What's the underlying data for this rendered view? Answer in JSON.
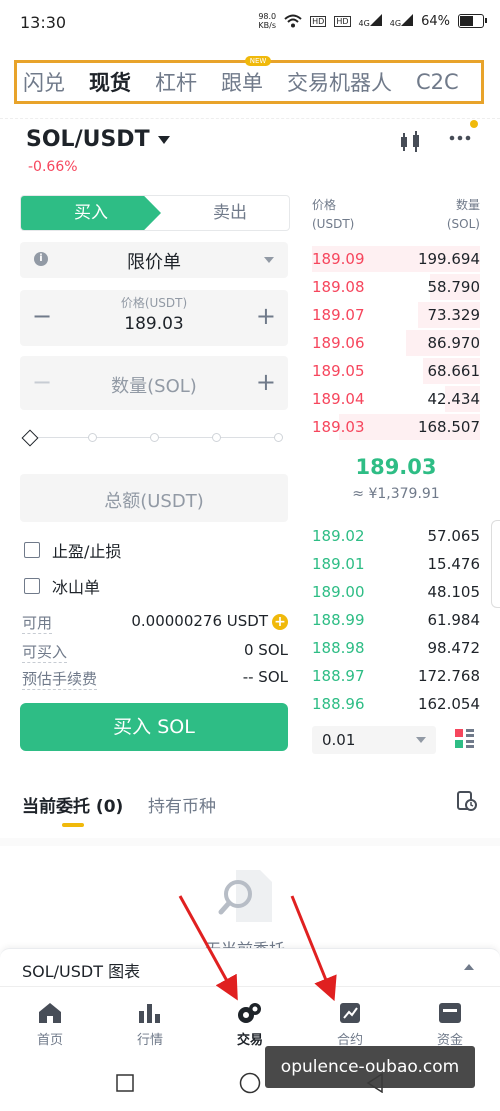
{
  "status": {
    "time": "13:30",
    "net_speed_value": "98.0",
    "net_speed_unit": "KB/s",
    "hd1": "HD",
    "hd2": "HD",
    "sig1": "4G",
    "sig2": "4G",
    "battery": "64%",
    "battery_level": 0.64
  },
  "tabs": [
    "闪兑",
    "现货",
    "杠杆",
    "跟单",
    "交易机器人",
    "C2C"
  ],
  "tabs_badge": "NEW",
  "pair": {
    "symbol": "SOL/USDT",
    "change": "-0.66%"
  },
  "trade": {
    "buy_label": "买入",
    "sell_label": "卖出",
    "order_type": "限价单",
    "price_caption": "价格(USDT)",
    "price_value": "189.03",
    "qty_placeholder": "数量(SOL)",
    "total_placeholder": "总额(USDT)",
    "tpsl_label": "止盈/止损",
    "iceberg_label": "冰山单",
    "available_label": "可用",
    "available_value": "0.00000276 USDT",
    "can_buy_label": "可买入",
    "can_buy_value": "0 SOL",
    "fee_label": "预估手续费",
    "fee_value": "-- SOL",
    "buy_button": "买入 SOL",
    "minus": "−",
    "plus": "+",
    "add_funds": "+"
  },
  "orderbook": {
    "price_header_1": "价格",
    "price_header_2": "(USDT)",
    "qty_header_1": "数量",
    "qty_header_2": "(SOL)",
    "asks": [
      {
        "price": "189.09",
        "qty": "199.694",
        "depth": 1.0
      },
      {
        "price": "189.08",
        "qty": "58.790",
        "depth": 0.3
      },
      {
        "price": "189.07",
        "qty": "73.329",
        "depth": 0.37
      },
      {
        "price": "189.06",
        "qty": "86.970",
        "depth": 0.44
      },
      {
        "price": "189.05",
        "qty": "68.661",
        "depth": 0.34
      },
      {
        "price": "189.04",
        "qty": "42.434",
        "depth": 0.21
      },
      {
        "price": "189.03",
        "qty": "168.507",
        "depth": 0.84
      }
    ],
    "last_price": "189.03",
    "last_price_cny": "≈ ¥1,379.91",
    "bids": [
      {
        "price": "189.02",
        "qty": "57.065"
      },
      {
        "price": "189.01",
        "qty": "15.476"
      },
      {
        "price": "189.00",
        "qty": "48.105"
      },
      {
        "price": "188.99",
        "qty": "61.984"
      },
      {
        "price": "188.98",
        "qty": "98.472"
      },
      {
        "price": "188.97",
        "qty": "172.768"
      },
      {
        "price": "188.96",
        "qty": "162.054"
      }
    ],
    "precision": "0.01"
  },
  "orders": {
    "tab_open": "当前委托 (0)",
    "tab_holdings": "持有币种",
    "empty_text": "无当前委托"
  },
  "chart_bar": {
    "label": "SOL/USDT 图表"
  },
  "nav": [
    {
      "label": "首页",
      "icon": "home-icon"
    },
    {
      "label": "行情",
      "icon": "markets-icon"
    },
    {
      "label": "交易",
      "icon": "trade-icon"
    },
    {
      "label": "合约",
      "icon": "futures-icon"
    },
    {
      "label": "资金",
      "icon": "wallet-icon"
    }
  ],
  "watermark": "opulence-oubao.com",
  "colors": {
    "green": "#2ebd85",
    "red": "#f6465d",
    "yellow": "#f0b90b",
    "highlight_border": "#e8a32a",
    "annotation_arrow": "#e02020"
  }
}
